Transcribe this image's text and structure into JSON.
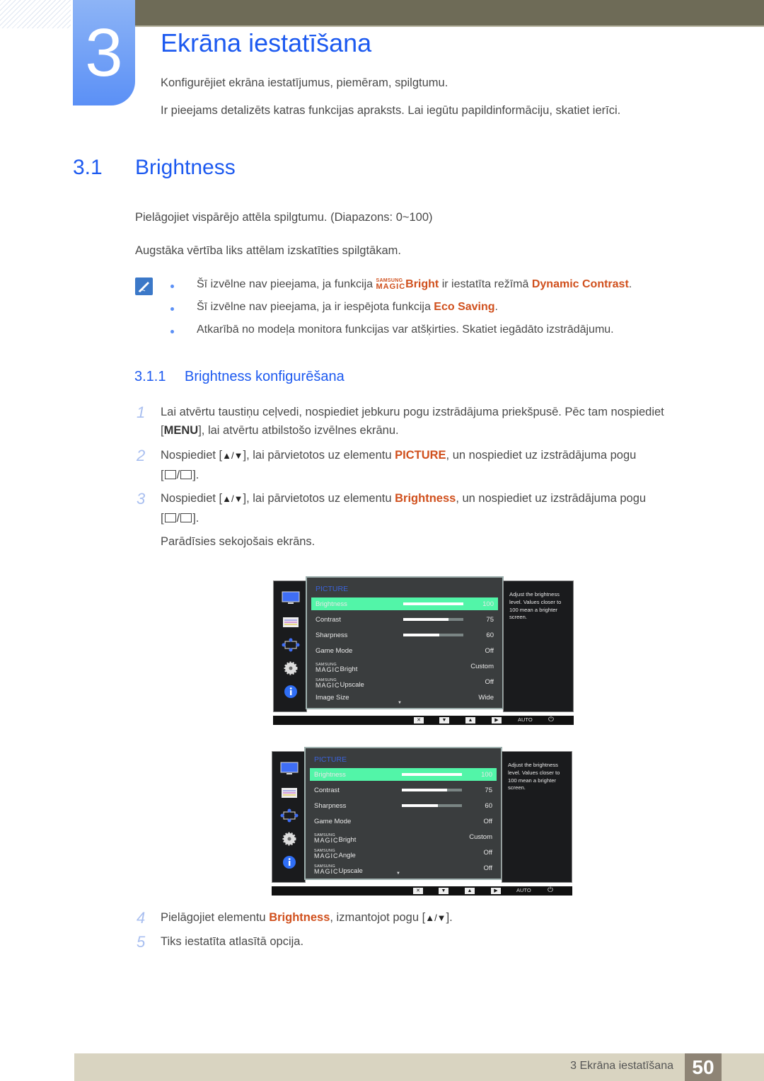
{
  "chapter": {
    "number": "3",
    "title": "Ekrāna iestatīšana",
    "intro": [
      "Konfigurējiet ekrāna iestatījumus, piemēram, spilgtumu.",
      "Ir pieejams detalizēts katras funkcijas apraksts. Lai iegūtu papildinformāciju, skatiet ierīci."
    ]
  },
  "section": {
    "number": "3.1",
    "title": "Brightness",
    "paragraphs": [
      "Pielāgojiet vispārējo attēla spilgtumu. (Diapazons: 0~100)",
      "Augstāka vērtība liks attēlam izskatīties spilgtākam."
    ]
  },
  "notes": {
    "icon": "note-pencil-icon",
    "items": [
      {
        "before": "Šī izvēlne nav pieejama, ja funkcija ",
        "magic_s": "SAMSUNG",
        "magic_m": "MAGIC",
        "highlight1": "Bright",
        "middle": " ir iestatīta režīmā ",
        "highlight2": "Dynamic Contrast",
        "after": "."
      },
      {
        "before": "Šī izvēlne nav pieejama, ja ir iespējota funkcija ",
        "highlight": "Eco Saving",
        "after": "."
      },
      {
        "text": "Atkarībā no modeļa monitora funkcijas var atšķirties. Skatiet iegādāto izstrādājumu."
      }
    ]
  },
  "subsection": {
    "number": "3.1.1",
    "title": "Brightness konfigurēšana"
  },
  "steps": [
    {
      "num": "1",
      "line1": "Lai atvērtu taustiņu ceļvedi, nospiediet jebkuru pogu izstrādājuma priekšpusē. Pēc tam nospiediet",
      "key": "MENU",
      "line2_after": "], lai atvērtu atbilstošo izvēlnes ekrānu."
    },
    {
      "num": "2",
      "before": "Nospiediet [",
      "arrows": "▲/▼",
      "middle": "], lai pārvietotos uz elementu ",
      "highlight": "PICTURE",
      "after": ", un nospiediet uz izstrādājuma pogu"
    },
    {
      "num": "3",
      "before": "Nospiediet [",
      "arrows": "▲/▼",
      "middle": "], lai pārvietotos uz elementu ",
      "highlight": "Brightness",
      "after": ", un nospiediet uz izstrādājuma pogu",
      "result": "Parādīsies sekojošais ekrāns."
    },
    {
      "num": "4",
      "before": "Pielāgojiet elementu ",
      "highlight": "Brightness",
      "middle": ", izmantojot pogu [",
      "arrows": "▲/▼",
      "after": "]."
    },
    {
      "num": "5",
      "text": "Tiks iestatīta atlasītā opcija."
    }
  ],
  "osd_screens": [
    {
      "category": "PICTURE",
      "help": "Adjust the brightness level. Values closer to 100 mean a brighter screen.",
      "rows": [
        {
          "label": "Brightness",
          "value": "100",
          "bar": 100,
          "selected": true
        },
        {
          "label": "Contrast",
          "value": "75",
          "bar": 75
        },
        {
          "label": "Sharpness",
          "value": "60",
          "bar": 60
        },
        {
          "label": "Game Mode",
          "value": "Off"
        },
        {
          "magic": true,
          "label": "Bright",
          "value": "Custom"
        },
        {
          "magic": true,
          "label": "Upscale",
          "value": "Off"
        },
        {
          "label": "Image Size",
          "value": "Wide"
        }
      ],
      "buttons": [
        "✕",
        "▼",
        "▲",
        "▶"
      ],
      "auto_label": "AUTO",
      "power_icon": "⏻"
    },
    {
      "category": "PICTURE",
      "help": "Adjust the brightness level. Values closer to 100 mean a brighter screen.",
      "rows": [
        {
          "label": "Brightness",
          "value": "100",
          "bar": 100,
          "selected": true
        },
        {
          "label": "Contrast",
          "value": "75",
          "bar": 75
        },
        {
          "label": "Sharpness",
          "value": "60",
          "bar": 60
        },
        {
          "label": "Game Mode",
          "value": "Off"
        },
        {
          "magic": true,
          "label": "Bright",
          "value": "Custom"
        },
        {
          "magic": true,
          "label": "Angle",
          "value": "Off"
        },
        {
          "magic": true,
          "label": "Upscale",
          "value": "Off"
        }
      ],
      "buttons": [
        "✕",
        "▼",
        "▲",
        "▶"
      ],
      "auto_label": "AUTO",
      "power_icon": "⏻"
    }
  ],
  "osd_magic": {
    "s": "SAMSUNG",
    "m": "MAGIC"
  },
  "footer": {
    "text": "3 Ekrāna iestatīšana",
    "page": "50"
  }
}
